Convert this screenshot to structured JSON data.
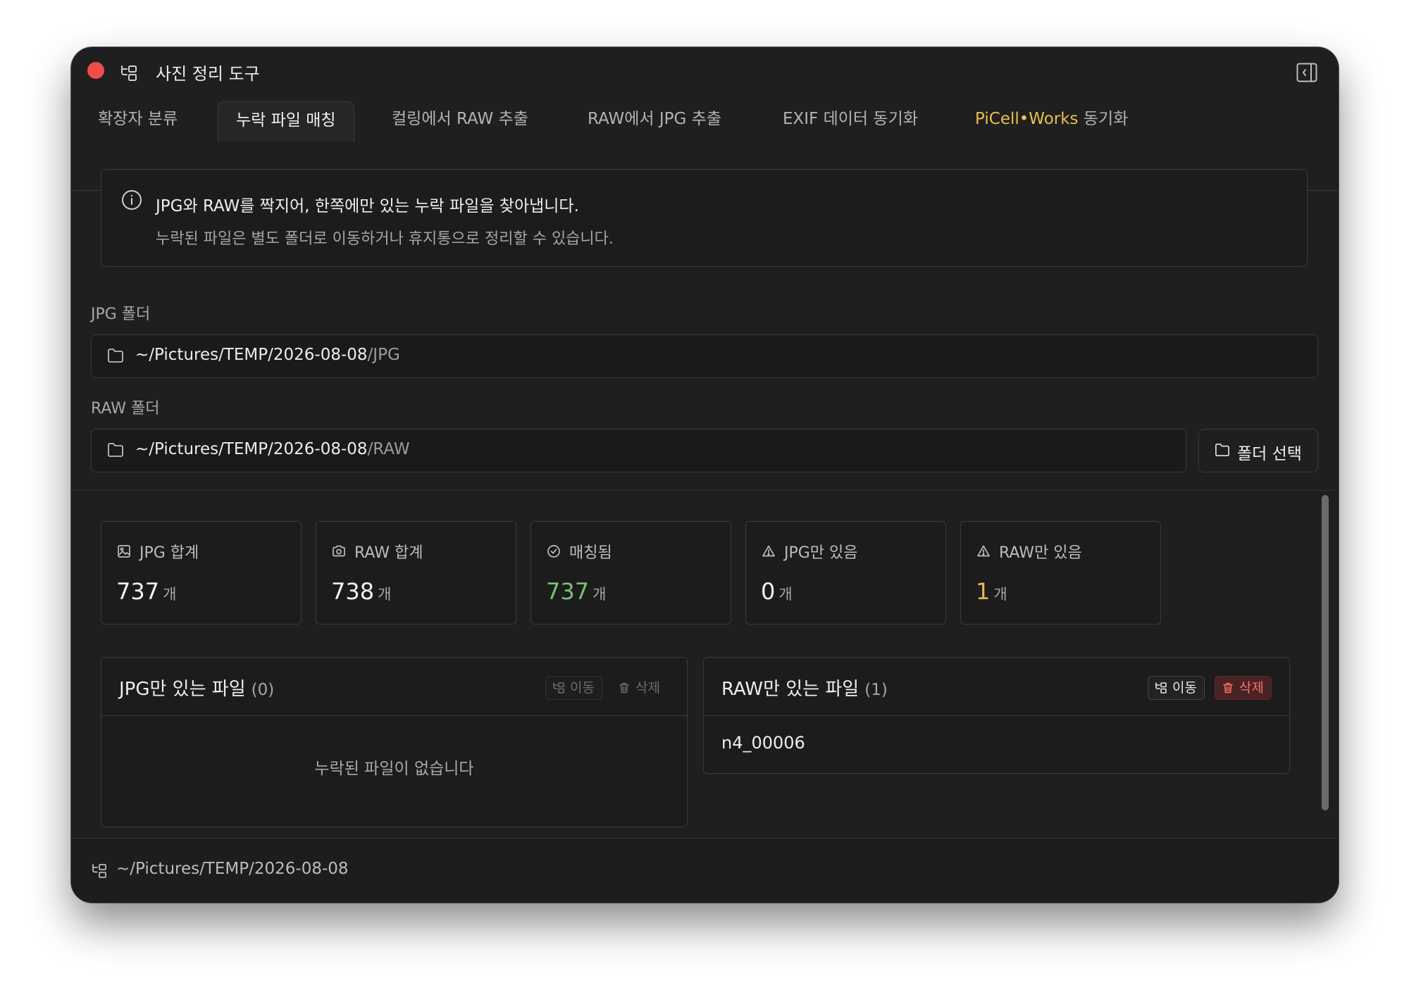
{
  "window": {
    "title": "사진 정리 도구"
  },
  "tabs": [
    {
      "label": "확장자 분류"
    },
    {
      "label": "누락 파일 매칭"
    },
    {
      "label": "컬링에서 RAW 추출"
    },
    {
      "label": "RAW에서 JPG 추출"
    },
    {
      "label": "EXIF 데이터 동기화"
    },
    {
      "label_accent": "PiCell•Works",
      "label_rest": " 동기화"
    }
  ],
  "active_tab": "누락 파일 매칭",
  "info": {
    "line1": "JPG와 RAW를 짝지어, 한쪽에만 있는 누락 파일을 찾아냅니다.",
    "line2": "누락된 파일은 별도 폴더로 이동하거나 휴지통으로 정리할 수 있습니다."
  },
  "jpg_folder": {
    "label": "JPG 폴더",
    "path_base": "~/Pictures/TEMP/2026-08-08",
    "path_tail": "/JPG"
  },
  "raw_folder": {
    "label": "RAW 폴더",
    "path_base": "~/Pictures/TEMP/2026-08-08",
    "path_tail": "/RAW"
  },
  "folder_select_label": "폴더 선택",
  "stats": [
    {
      "label": "JPG 합계",
      "value": "737",
      "unit": "개",
      "icon": "image-icon"
    },
    {
      "label": "RAW 합계",
      "value": "738",
      "unit": "개",
      "icon": "camera-icon"
    },
    {
      "label": "매칭됨",
      "value": "737",
      "unit": "개",
      "icon": "check-circle-icon"
    },
    {
      "label": "JPG만 있음",
      "value": "0",
      "unit": "개",
      "icon": "warning-icon"
    },
    {
      "label": "RAW만 있음",
      "value": "1",
      "unit": "개",
      "icon": "warning-icon"
    }
  ],
  "jpg_only_panel": {
    "title": "JPG만 있는 파일",
    "count": "(0)",
    "move_label": "이동",
    "delete_label": "삭제",
    "empty_message": "누락된 파일이 없습니다"
  },
  "raw_only_panel": {
    "title": "RAW만 있는 파일",
    "count": "(1)",
    "move_label": "이동",
    "delete_label": "삭제",
    "files": [
      "n4_00006"
    ]
  },
  "footer": {
    "path": "~/Pictures/TEMP/2026-08-08"
  },
  "colors": {
    "accent_yellow": "#e8c04a",
    "matched_green": "#7ac07a",
    "warning_yellow": "#e5b94a",
    "danger_red": "#f07272",
    "close_red": "#ee4d4a"
  }
}
